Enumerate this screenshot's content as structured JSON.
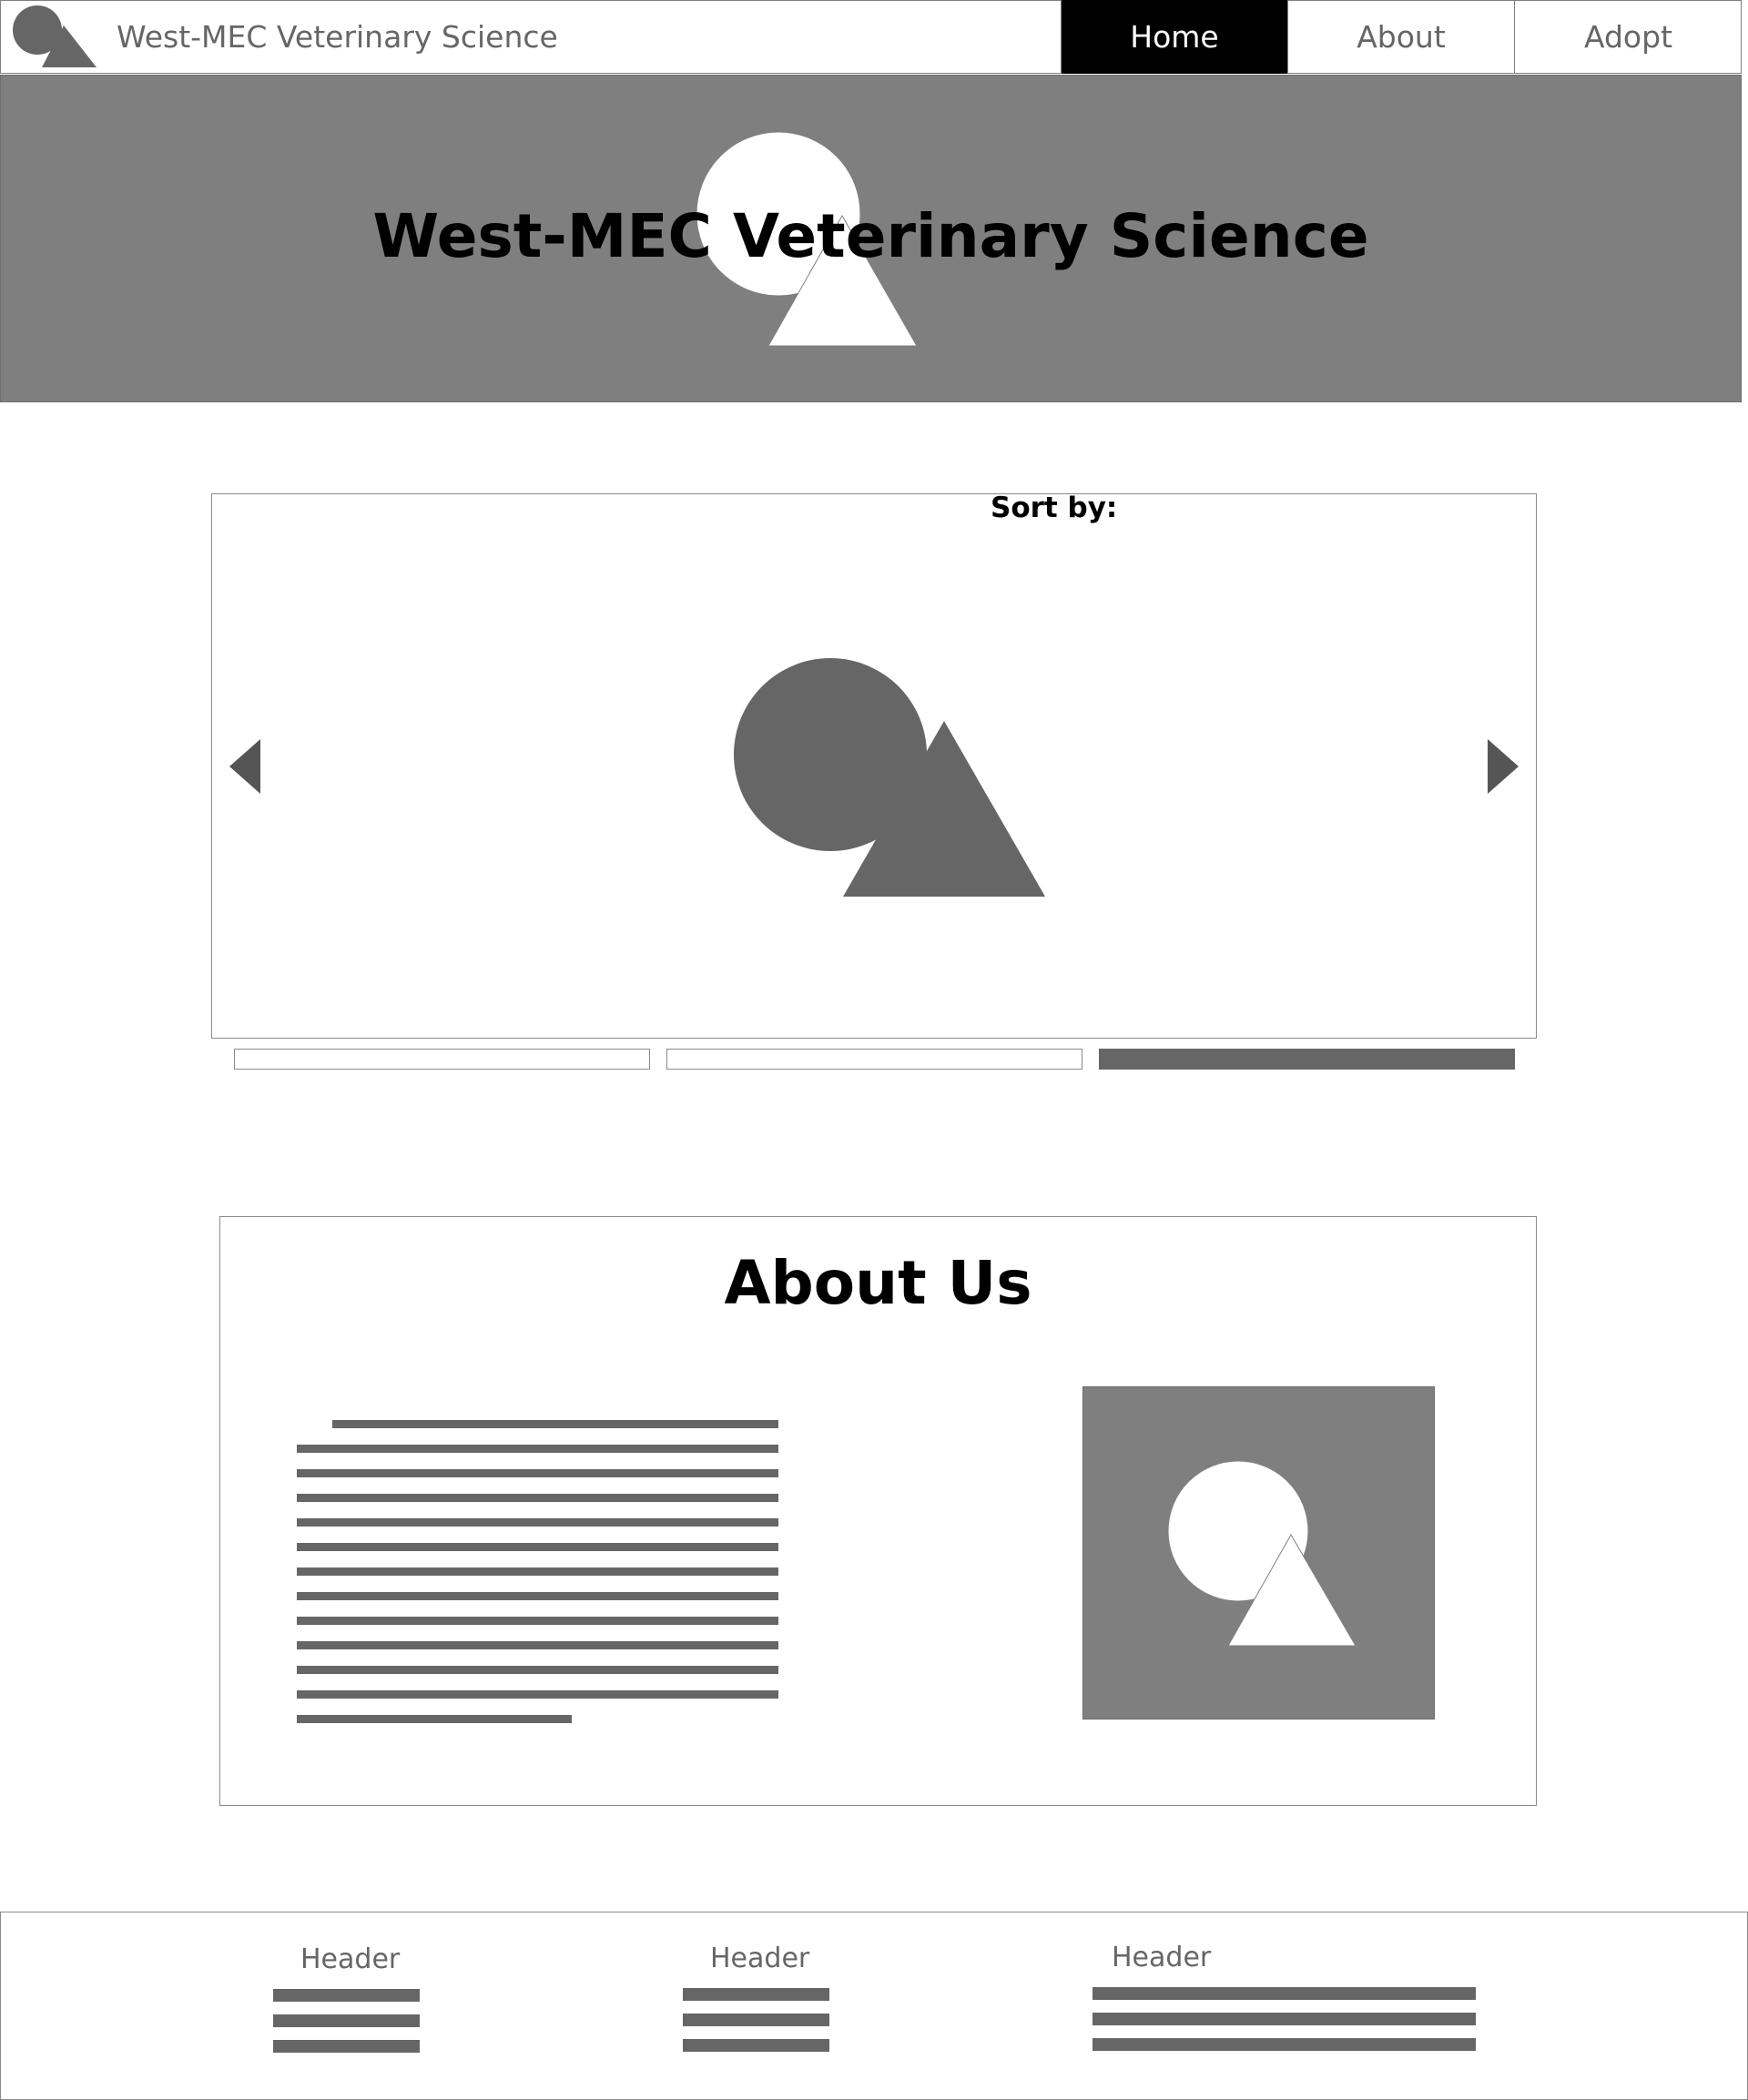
{
  "navbar": {
    "brand": "West-MEC Veterinary Science",
    "logo_icon": "placeholder-image-icon",
    "items": [
      {
        "label": "Home",
        "active": true
      },
      {
        "label": "About",
        "active": false
      },
      {
        "label": "Adopt",
        "active": false
      }
    ]
  },
  "hero": {
    "title": "West-MEC Veterinary Science",
    "image_icon": "placeholder-image-icon"
  },
  "carousel": {
    "sort_label": "Sort by:",
    "slide_icon": "placeholder-image-icon",
    "prev_icon": "chevron-left-icon",
    "next_icon": "chevron-right-icon",
    "slide_count": 3,
    "active_slide": 3
  },
  "about": {
    "title": "About Us",
    "image_icon": "placeholder-image-icon"
  },
  "footer": {
    "columns": [
      {
        "header": "Header"
      },
      {
        "header": "Header"
      },
      {
        "header": "Header"
      }
    ]
  },
  "colors": {
    "placeholder_gray": "#7f7f7f",
    "shape_dark": "#666666",
    "active_nav": "#000000",
    "border": "#8a8a8a"
  }
}
